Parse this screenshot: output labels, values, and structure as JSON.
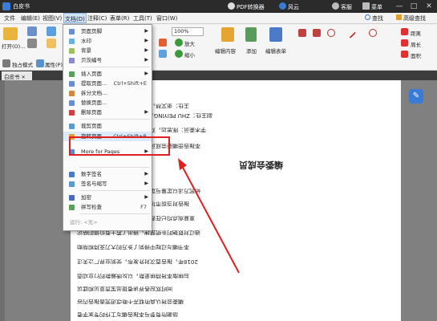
{
  "window": {
    "title": "白皮书",
    "links": [
      "PDF转换器",
      "风云",
      "客服",
      "菜单"
    ],
    "controls": [
      "—",
      "□",
      "✕"
    ]
  },
  "menubar": {
    "items": [
      "文件",
      "编辑(E)",
      "视图(V)",
      "文档(D)",
      "注释(C)",
      "表单(R)",
      "工具(T)",
      "窗口(W)"
    ],
    "right": [
      "查找",
      "高级查找"
    ]
  },
  "toolbar": {
    "open_label": "打开(O)...",
    "sidebar_btns": [
      "独占模式",
      "属性(P)..."
    ],
    "zoom_value": "100%",
    "zoom_in": "放大",
    "zoom_out": "缩小",
    "edit_content": "编辑内容",
    "add": "添加",
    "edit_form": "编辑表单",
    "distance": "距离",
    "perimeter": "周长",
    "area": "面积"
  },
  "document": {
    "tab": "白皮书"
  },
  "dropdown": {
    "items": [
      {
        "label": "页面页脚",
        "shortcut": "",
        "sub": true
      },
      {
        "label": "水印",
        "shortcut": "",
        "sub": true
      },
      {
        "label": "背景",
        "shortcut": "",
        "sub": true
      },
      {
        "label": "贝茨编号",
        "shortcut": "",
        "sub": true
      },
      {
        "label": "插入页面",
        "shortcut": "",
        "sub": true
      },
      {
        "label": "提取页面...",
        "shortcut": "Ctrl+Shift+E",
        "sub": false
      },
      {
        "label": "拆分文档...",
        "shortcut": "",
        "sub": false
      },
      {
        "label": "替换页面...",
        "shortcut": "",
        "sub": false
      },
      {
        "label": "删除页面",
        "shortcut": "",
        "sub": true
      },
      {
        "label": "裁剪页面",
        "shortcut": "",
        "sub": false
      },
      {
        "label": "旋转页面...",
        "shortcut": "Ctrl+Shift+R",
        "sub": false
      },
      {
        "label": "More for Pages",
        "shortcut": "",
        "sub": true
      },
      {
        "label": "数字签名",
        "shortcut": "",
        "sub": true
      },
      {
        "label": "签名与缩写",
        "shortcut": "",
        "sub": true
      },
      {
        "label": "加密",
        "shortcut": "",
        "sub": true
      },
      {
        "label": "拼写检查",
        "shortcut": "F7",
        "sub": false
      },
      {
        "label": "运行: <无>",
        "shortcut": "",
        "sub": true
      }
    ]
  },
  "page": {
    "heading": "编委会成员",
    "lines": [
      "编委会成员：Wilson Michele",
      "主任：张文林，许洋，刘楚，翁飞燕，孙大卫",
      "副主任：ZHU PEIYING，LIAO HONG，张丽，王小琳",
      "学术委员：陈思远，刘海洋，郑宏伟，王建国，李明",
      "本报告由编委会成员共同编写，数据来源真实可靠",
      "研究方法以定量与定性分析相结合，经过反复论证",
      "报告对当前市场趋势进行了深入的研究与探讨",
      "重要观点均已在各章节中详细阐述，供读者参考",
      "通过对数据的系统整理，得出了若干有价值的结论",
      "本书编写过程中得到了多方的大力支持和帮助",
      "2018年，报告首次对外发布，受到业界广泛关注",
      "后续版本将持续更新，以反映最新的行业动态",
      "同时欢迎各界读者提出宝贵意见和建议",
      "编委会将认真听取并不断改进完善报告内容",
      "感谢所有参与本报告编写工作的专家学者"
    ]
  },
  "colors": {
    "accent": "#3a7bd5",
    "highlight": "#e02020",
    "titlebar": "#2b2b2b"
  }
}
